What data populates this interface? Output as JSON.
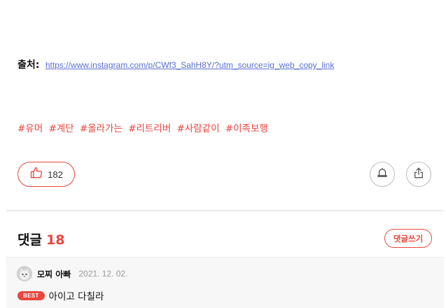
{
  "source": {
    "label": "출처:",
    "link": "https://www.instagram.com/p/CWf3_SahH8Y/?utm_source=ig_web_copy_link"
  },
  "tags": [
    "#유머",
    "#계단",
    "#올라가는",
    "#리트리버",
    "#사람같이",
    "#이족보행"
  ],
  "like": {
    "icon": "thumbs-up-icon",
    "count": "182"
  },
  "actions": {
    "subscribe_icon": "bell-icon",
    "share_icon": "share-icon"
  },
  "comments": {
    "title": "댓글",
    "count": "18",
    "write_label": "댓글쓰기",
    "items": [
      {
        "author": "모찌 아빠",
        "date": "2021. 12. 02.",
        "badge": "BEST",
        "text": "아이고 다칠라"
      }
    ]
  },
  "colors": {
    "accent": "#e8463e",
    "link": "#5b70d6"
  }
}
